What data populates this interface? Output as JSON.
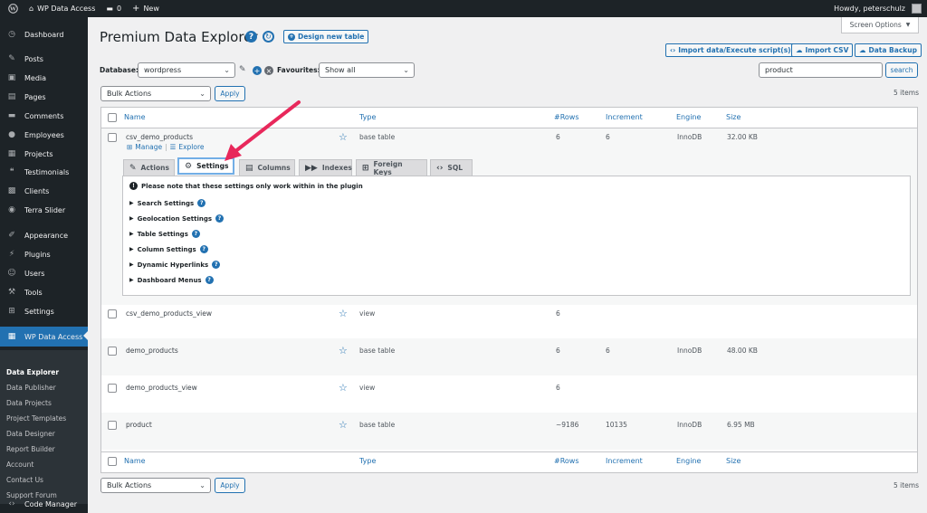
{
  "adminbar": {
    "site_name": "WP Data Access",
    "comments_count": "0",
    "new_label": "New",
    "howdy": "Howdy, peterschulz"
  },
  "sidebar": {
    "items": [
      {
        "label": "Dashboard",
        "icon": "dashboard-icon",
        "glyph": "◷"
      },
      {
        "label": "Posts",
        "icon": "pin-icon",
        "glyph": "✎"
      },
      {
        "label": "Media",
        "icon": "media-icon",
        "glyph": "▣"
      },
      {
        "label": "Pages",
        "icon": "pages-icon",
        "glyph": "▤"
      },
      {
        "label": "Comments",
        "icon": "comments-icon",
        "glyph": "▬"
      },
      {
        "label": "Employees",
        "icon": "employees-icon",
        "glyph": "●"
      },
      {
        "label": "Projects",
        "icon": "projects-icon",
        "glyph": "▦"
      },
      {
        "label": "Testimonials",
        "icon": "quote-icon",
        "glyph": "❝"
      },
      {
        "label": "Clients",
        "icon": "clients-icon",
        "glyph": "▩"
      },
      {
        "label": "Terra Slider",
        "icon": "slider-icon",
        "glyph": "◉"
      },
      {
        "label": "Appearance",
        "icon": "appearance-icon",
        "glyph": "✐"
      },
      {
        "label": "Plugins",
        "icon": "plugins-icon",
        "glyph": "⚡"
      },
      {
        "label": "Users",
        "icon": "users-icon",
        "glyph": "☺"
      },
      {
        "label": "Tools",
        "icon": "tools-icon",
        "glyph": "⚒"
      },
      {
        "label": "Settings",
        "icon": "settings-icon",
        "glyph": "⊞"
      },
      {
        "label": "WP Data Access",
        "icon": "table-icon",
        "glyph": "▦"
      },
      {
        "label": "Code Manager",
        "icon": "code-icon",
        "glyph": "‹›"
      }
    ],
    "submenu": [
      "Data Explorer",
      "Data Publisher",
      "Data Projects",
      "Project Templates",
      "Data Designer",
      "Report Builder",
      "Account",
      "Contact Us",
      "Support Forum"
    ]
  },
  "header": {
    "title": "Premium Data Explorer",
    "help_glyph": "?",
    "refresh_glyph": "↻",
    "design_new_table": "Design new table",
    "screen_options": "Screen Options",
    "import_data": "Import data/Execute script(s)",
    "import_csv": "Import CSV",
    "data_backup": "Data Backup"
  },
  "filters": {
    "database_label": "Database:",
    "database_value": "wordpress",
    "favourites_label": "Favourites:",
    "favourites_value": "Show all",
    "search_value": "product",
    "search_button": "search",
    "bulk_actions": "Bulk Actions",
    "apply": "Apply",
    "items_count": "5 items"
  },
  "table": {
    "columns": [
      "Name",
      "Type",
      "#Rows",
      "Increment",
      "Engine",
      "Size"
    ],
    "rows": [
      {
        "name": "csv_demo_products",
        "type": "base table",
        "rows": "6",
        "increment": "6",
        "engine": "InnoDB",
        "size": "32.00 KB"
      },
      {
        "name": "csv_demo_products_view",
        "type": "view",
        "rows": "6",
        "increment": "",
        "engine": "",
        "size": ""
      },
      {
        "name": "demo_products",
        "type": "base table",
        "rows": "6",
        "increment": "6",
        "engine": "InnoDB",
        "size": "48.00 KB"
      },
      {
        "name": "demo_products_view",
        "type": "view",
        "rows": "6",
        "increment": "",
        "engine": "",
        "size": ""
      },
      {
        "name": "product",
        "type": "base table",
        "rows": "~9186",
        "increment": "10135",
        "engine": "InnoDB",
        "size": "6.95 MB"
      }
    ],
    "row_actions": {
      "manage": "Manage",
      "explore": "Explore",
      "separator": "|"
    }
  },
  "tabs": [
    {
      "label": "Actions",
      "icon": "wrench-icon",
      "glyph": "🔧"
    },
    {
      "label": "Settings",
      "icon": "gear-icon",
      "glyph": "⚙"
    },
    {
      "label": "Columns",
      "icon": "columns-icon",
      "glyph": "▤"
    },
    {
      "label": "Indexes",
      "icon": "indexes-icon",
      "glyph": "⏩"
    },
    {
      "label": "Foreign Keys",
      "icon": "sitemap-icon",
      "glyph": "⊞"
    },
    {
      "label": "SQL",
      "icon": "code-icon",
      "glyph": "‹›"
    }
  ],
  "settings_panel": {
    "notice": "Please note that these settings only work within in the plugin",
    "items": [
      "Search Settings",
      "Geolocation Settings",
      "Table Settings",
      "Column Settings",
      "Dynamic Hyperlinks",
      "Dashboard Menus"
    ]
  },
  "colors": {
    "accent": "#2271b1",
    "sidebar_bg": "#1d2327",
    "arrow": "#e8285b"
  }
}
